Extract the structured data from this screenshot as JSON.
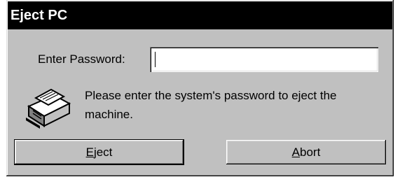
{
  "window": {
    "title": "Eject PC"
  },
  "form": {
    "password_label": "Enter Password:",
    "password_value": "",
    "password_placeholder": ""
  },
  "message": {
    "icon": "pc-card-drive-icon",
    "text": "Please enter the system's password to eject the machine."
  },
  "buttons": {
    "eject": {
      "accel": "E",
      "rest": "ject"
    },
    "abort": {
      "accel": "A",
      "rest": "bort"
    }
  },
  "colors": {
    "face": "#c0c0c0",
    "titlebar": "#000000",
    "title_text": "#ffffff"
  }
}
